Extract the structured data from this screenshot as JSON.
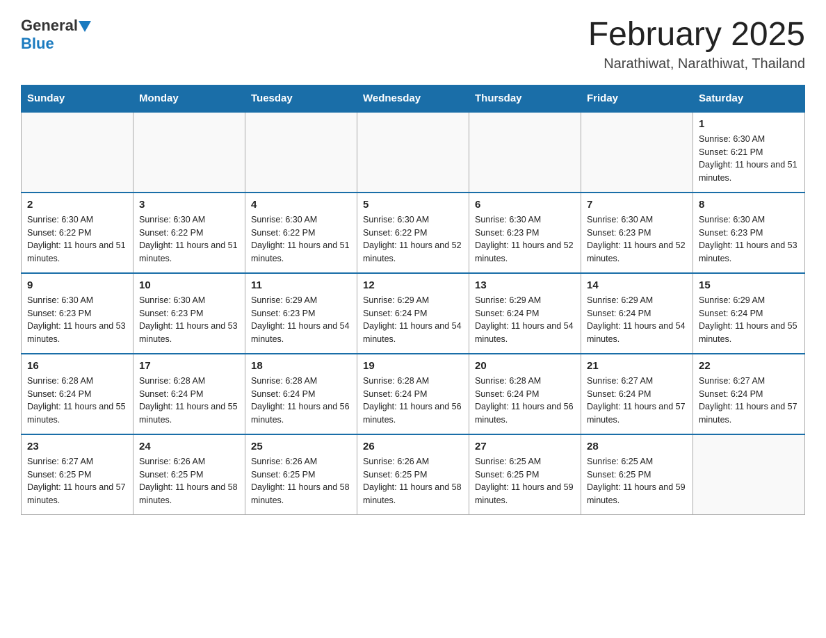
{
  "header": {
    "logo_general": "General",
    "logo_blue": "Blue",
    "month_title": "February 2025",
    "location": "Narathiwat, Narathiwat, Thailand"
  },
  "weekdays": [
    "Sunday",
    "Monday",
    "Tuesday",
    "Wednesday",
    "Thursday",
    "Friday",
    "Saturday"
  ],
  "weeks": [
    [
      {
        "day": "",
        "sunrise": "",
        "sunset": "",
        "daylight": "",
        "empty": true
      },
      {
        "day": "",
        "sunrise": "",
        "sunset": "",
        "daylight": "",
        "empty": true
      },
      {
        "day": "",
        "sunrise": "",
        "sunset": "",
        "daylight": "",
        "empty": true
      },
      {
        "day": "",
        "sunrise": "",
        "sunset": "",
        "daylight": "",
        "empty": true
      },
      {
        "day": "",
        "sunrise": "",
        "sunset": "",
        "daylight": "",
        "empty": true
      },
      {
        "day": "",
        "sunrise": "",
        "sunset": "",
        "daylight": "",
        "empty": true
      },
      {
        "day": "1",
        "sunrise": "Sunrise: 6:30 AM",
        "sunset": "Sunset: 6:21 PM",
        "daylight": "Daylight: 11 hours and 51 minutes.",
        "empty": false
      }
    ],
    [
      {
        "day": "2",
        "sunrise": "Sunrise: 6:30 AM",
        "sunset": "Sunset: 6:22 PM",
        "daylight": "Daylight: 11 hours and 51 minutes.",
        "empty": false
      },
      {
        "day": "3",
        "sunrise": "Sunrise: 6:30 AM",
        "sunset": "Sunset: 6:22 PM",
        "daylight": "Daylight: 11 hours and 51 minutes.",
        "empty": false
      },
      {
        "day": "4",
        "sunrise": "Sunrise: 6:30 AM",
        "sunset": "Sunset: 6:22 PM",
        "daylight": "Daylight: 11 hours and 51 minutes.",
        "empty": false
      },
      {
        "day": "5",
        "sunrise": "Sunrise: 6:30 AM",
        "sunset": "Sunset: 6:22 PM",
        "daylight": "Daylight: 11 hours and 52 minutes.",
        "empty": false
      },
      {
        "day": "6",
        "sunrise": "Sunrise: 6:30 AM",
        "sunset": "Sunset: 6:23 PM",
        "daylight": "Daylight: 11 hours and 52 minutes.",
        "empty": false
      },
      {
        "day": "7",
        "sunrise": "Sunrise: 6:30 AM",
        "sunset": "Sunset: 6:23 PM",
        "daylight": "Daylight: 11 hours and 52 minutes.",
        "empty": false
      },
      {
        "day": "8",
        "sunrise": "Sunrise: 6:30 AM",
        "sunset": "Sunset: 6:23 PM",
        "daylight": "Daylight: 11 hours and 53 minutes.",
        "empty": false
      }
    ],
    [
      {
        "day": "9",
        "sunrise": "Sunrise: 6:30 AM",
        "sunset": "Sunset: 6:23 PM",
        "daylight": "Daylight: 11 hours and 53 minutes.",
        "empty": false
      },
      {
        "day": "10",
        "sunrise": "Sunrise: 6:30 AM",
        "sunset": "Sunset: 6:23 PM",
        "daylight": "Daylight: 11 hours and 53 minutes.",
        "empty": false
      },
      {
        "day": "11",
        "sunrise": "Sunrise: 6:29 AM",
        "sunset": "Sunset: 6:23 PM",
        "daylight": "Daylight: 11 hours and 54 minutes.",
        "empty": false
      },
      {
        "day": "12",
        "sunrise": "Sunrise: 6:29 AM",
        "sunset": "Sunset: 6:24 PM",
        "daylight": "Daylight: 11 hours and 54 minutes.",
        "empty": false
      },
      {
        "day": "13",
        "sunrise": "Sunrise: 6:29 AM",
        "sunset": "Sunset: 6:24 PM",
        "daylight": "Daylight: 11 hours and 54 minutes.",
        "empty": false
      },
      {
        "day": "14",
        "sunrise": "Sunrise: 6:29 AM",
        "sunset": "Sunset: 6:24 PM",
        "daylight": "Daylight: 11 hours and 54 minutes.",
        "empty": false
      },
      {
        "day": "15",
        "sunrise": "Sunrise: 6:29 AM",
        "sunset": "Sunset: 6:24 PM",
        "daylight": "Daylight: 11 hours and 55 minutes.",
        "empty": false
      }
    ],
    [
      {
        "day": "16",
        "sunrise": "Sunrise: 6:28 AM",
        "sunset": "Sunset: 6:24 PM",
        "daylight": "Daylight: 11 hours and 55 minutes.",
        "empty": false
      },
      {
        "day": "17",
        "sunrise": "Sunrise: 6:28 AM",
        "sunset": "Sunset: 6:24 PM",
        "daylight": "Daylight: 11 hours and 55 minutes.",
        "empty": false
      },
      {
        "day": "18",
        "sunrise": "Sunrise: 6:28 AM",
        "sunset": "Sunset: 6:24 PM",
        "daylight": "Daylight: 11 hours and 56 minutes.",
        "empty": false
      },
      {
        "day": "19",
        "sunrise": "Sunrise: 6:28 AM",
        "sunset": "Sunset: 6:24 PM",
        "daylight": "Daylight: 11 hours and 56 minutes.",
        "empty": false
      },
      {
        "day": "20",
        "sunrise": "Sunrise: 6:28 AM",
        "sunset": "Sunset: 6:24 PM",
        "daylight": "Daylight: 11 hours and 56 minutes.",
        "empty": false
      },
      {
        "day": "21",
        "sunrise": "Sunrise: 6:27 AM",
        "sunset": "Sunset: 6:24 PM",
        "daylight": "Daylight: 11 hours and 57 minutes.",
        "empty": false
      },
      {
        "day": "22",
        "sunrise": "Sunrise: 6:27 AM",
        "sunset": "Sunset: 6:24 PM",
        "daylight": "Daylight: 11 hours and 57 minutes.",
        "empty": false
      }
    ],
    [
      {
        "day": "23",
        "sunrise": "Sunrise: 6:27 AM",
        "sunset": "Sunset: 6:25 PM",
        "daylight": "Daylight: 11 hours and 57 minutes.",
        "empty": false
      },
      {
        "day": "24",
        "sunrise": "Sunrise: 6:26 AM",
        "sunset": "Sunset: 6:25 PM",
        "daylight": "Daylight: 11 hours and 58 minutes.",
        "empty": false
      },
      {
        "day": "25",
        "sunrise": "Sunrise: 6:26 AM",
        "sunset": "Sunset: 6:25 PM",
        "daylight": "Daylight: 11 hours and 58 minutes.",
        "empty": false
      },
      {
        "day": "26",
        "sunrise": "Sunrise: 6:26 AM",
        "sunset": "Sunset: 6:25 PM",
        "daylight": "Daylight: 11 hours and 58 minutes.",
        "empty": false
      },
      {
        "day": "27",
        "sunrise": "Sunrise: 6:25 AM",
        "sunset": "Sunset: 6:25 PM",
        "daylight": "Daylight: 11 hours and 59 minutes.",
        "empty": false
      },
      {
        "day": "28",
        "sunrise": "Sunrise: 6:25 AM",
        "sunset": "Sunset: 6:25 PM",
        "daylight": "Daylight: 11 hours and 59 minutes.",
        "empty": false
      },
      {
        "day": "",
        "sunrise": "",
        "sunset": "",
        "daylight": "",
        "empty": true
      }
    ]
  ]
}
